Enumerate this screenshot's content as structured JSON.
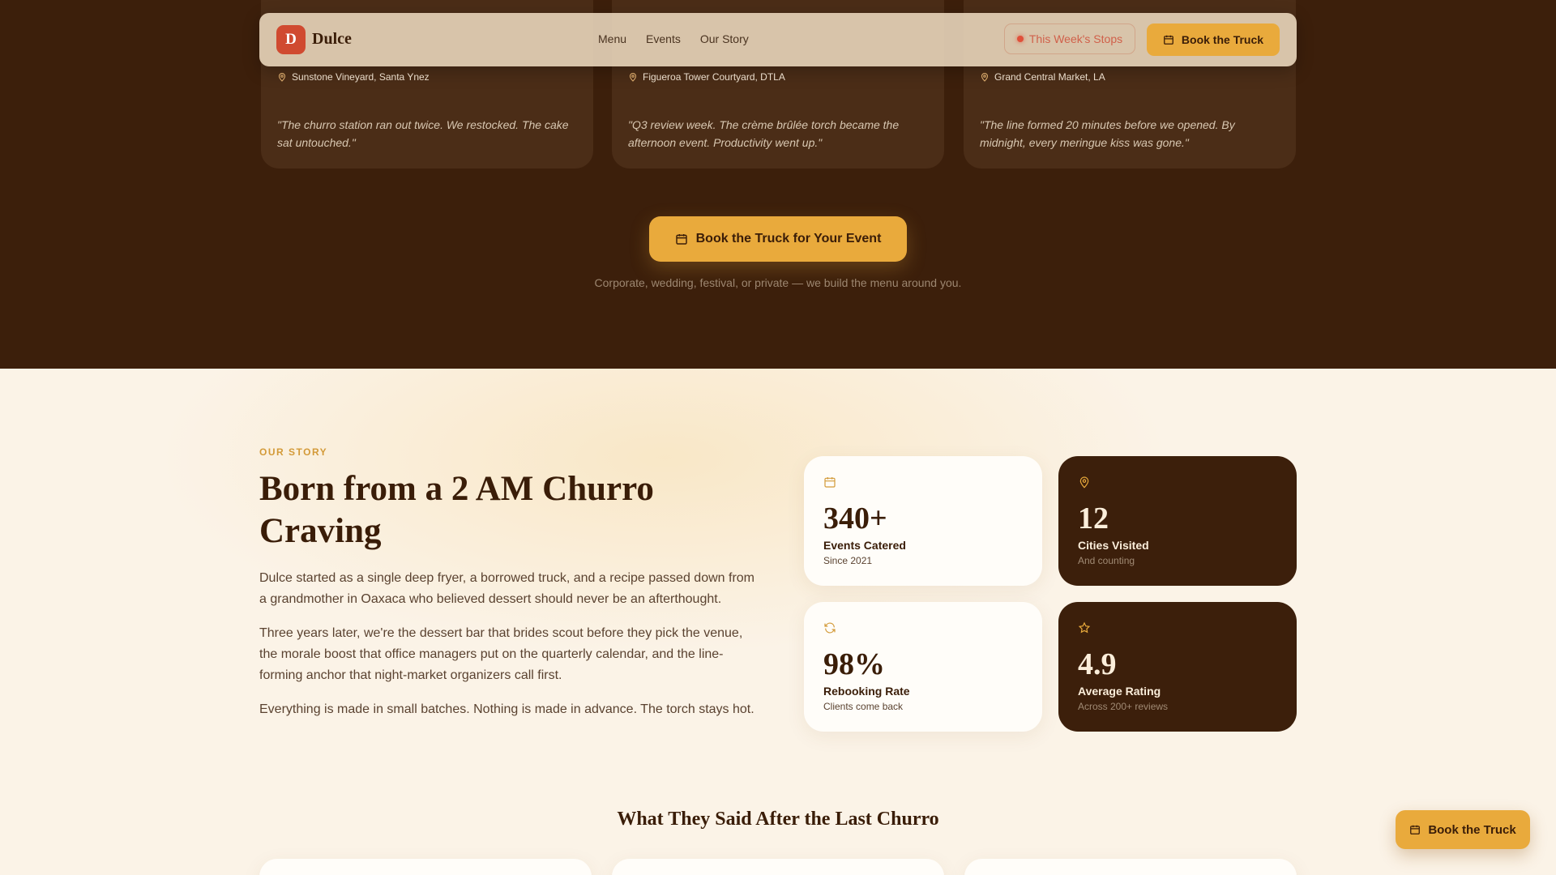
{
  "nav": {
    "logo_letter": "D",
    "brand": "Dulce",
    "links": [
      "Menu",
      "Events",
      "Our Story"
    ],
    "stops_label": "This Week's Stops",
    "book_label": "Book the Truck"
  },
  "events": [
    {
      "location": "Sunstone Vineyard, Santa Ynez",
      "quote": "\"The churro station ran out twice. We restocked. The cake sat untouched.\""
    },
    {
      "location": "Figueroa Tower Courtyard, DTLA",
      "quote": "\"Q3 review week. The crème brûlée torch became the afternoon event. Productivity went up.\""
    },
    {
      "location": "Grand Central Market, LA",
      "quote": "\"The line formed 20 minutes before we opened. By midnight, every meringue kiss was gone.\""
    }
  ],
  "cta": {
    "label": "Book the Truck for Your Event",
    "sub": "Corporate, wedding, festival, or private — we build the menu around you."
  },
  "story": {
    "eyebrow": "OUR STORY",
    "title": "Born from a 2 AM Churro Craving",
    "paragraphs": [
      "Dulce started as a single deep fryer, a borrowed truck, and a recipe passed down from a grandmother in Oaxaca who believed dessert should never be an afterthought.",
      "Three years later, we're the dessert bar that brides scout before they pick the venue, the morale boost that office managers put on the quarterly calendar, and the line-forming anchor that night-market organizers call first.",
      "Everything is made in small batches. Nothing is made in advance. The torch stays hot."
    ]
  },
  "stats": [
    {
      "icon": "calendar-icon",
      "value": "340+",
      "label": "Events Catered",
      "sub": "Since 2021"
    },
    {
      "icon": "map-pin-icon",
      "value": "12",
      "label": "Cities Visited",
      "sub": "And counting"
    },
    {
      "icon": "refresh-icon",
      "value": "98%",
      "label": "Rebooking Rate",
      "sub": "Clients come back"
    },
    {
      "icon": "star-icon",
      "value": "4.9",
      "label": "Average Rating",
      "sub": "Across 200+ reviews"
    }
  ],
  "testimonials": {
    "title": "What They Said After the Last Churro"
  },
  "floating": {
    "book_label": "Book the Truck"
  },
  "colors": {
    "accent": "#e9aa3c",
    "dark": "#3c1f0b",
    "cream": "#fbf3e7",
    "brand_red": "#d04a30"
  }
}
